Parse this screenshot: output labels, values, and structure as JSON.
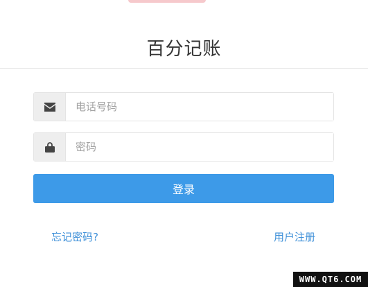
{
  "app": {
    "title": "百分记账"
  },
  "form": {
    "phone": {
      "placeholder": "电话号码",
      "value": "",
      "icon": "envelope-icon"
    },
    "password": {
      "placeholder": "密码",
      "value": "",
      "icon": "lock-icon"
    },
    "login_label": "登录"
  },
  "links": {
    "forgot_password": "忘记密码?",
    "register": "用户注册"
  },
  "watermark": {
    "text": "WWW.QT6.COM"
  },
  "colors": {
    "accent": "#3d9ae8",
    "link": "#3d8fd8",
    "top_accent": "#f6c9cc"
  }
}
